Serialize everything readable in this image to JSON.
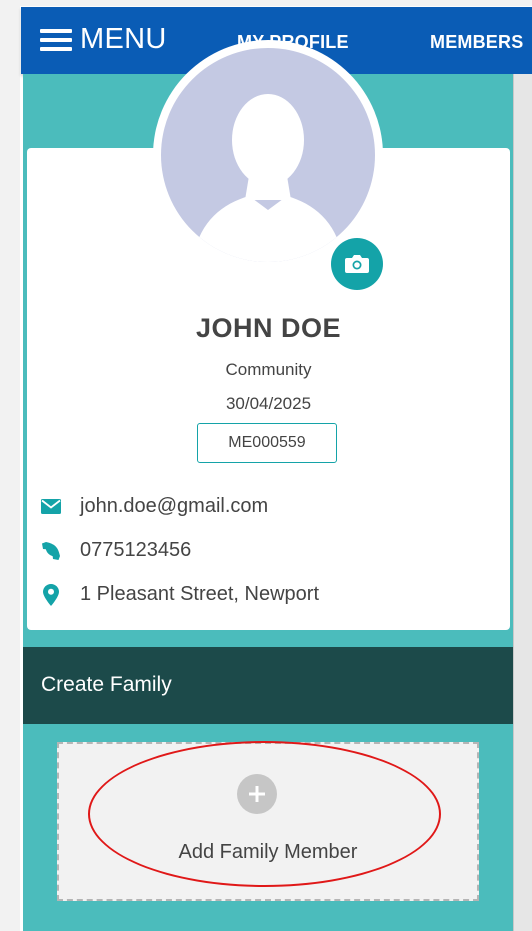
{
  "nav": {
    "menu_label": "MENU",
    "profile_label": "MY PROFILE",
    "members_label": "MEMBERS"
  },
  "profile": {
    "name": "JOHN DOE",
    "role": "Community",
    "date": "30/04/2025",
    "member_id": "ME000559",
    "email": "john.doe@gmail.com",
    "phone": "0775123456",
    "address": "1 Pleasant Street, Newport"
  },
  "family": {
    "section_title": "Create Family",
    "add_label": "Add Family Member"
  },
  "icons": {
    "menu": "hamburger-icon",
    "camera": "camera-icon",
    "email": "envelope-icon",
    "phone": "phone-icon",
    "address": "map-marker-icon",
    "add": "plus-circle-icon"
  },
  "colors": {
    "navbar": "#0a5cb5",
    "panel": "#4bbcbc",
    "accent": "#14a3a8",
    "section_header": "#1c4a4a",
    "highlight": "#e01818"
  }
}
